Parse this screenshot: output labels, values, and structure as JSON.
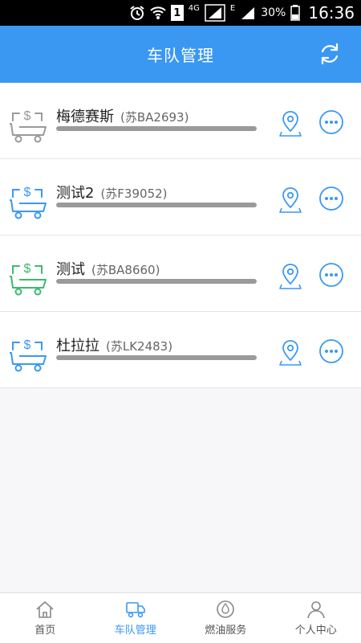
{
  "status_bar": {
    "time": "16:36",
    "battery": "30%",
    "network_4g": "4G",
    "network_e": "E",
    "sim": "1"
  },
  "header": {
    "title": "车队管理",
    "refresh_icon": "refresh-icon"
  },
  "colors": {
    "primary": "#3a98f3",
    "truck_gray": "#9a9a9a",
    "truck_blue": "#3a98f3",
    "truck_green": "#3cba6e"
  },
  "vehicles": [
    {
      "name": "梅德赛斯",
      "plate": "(苏BA2693)",
      "truck_color": "#9a9a9a"
    },
    {
      "name": "测试2",
      "plate": "(苏F39052)",
      "truck_color": "#3a98f3"
    },
    {
      "name": "测试",
      "plate": "(苏BA8660)",
      "truck_color": "#3cba6e"
    },
    {
      "name": "杜拉拉",
      "plate": "(苏LK2483)",
      "truck_color": "#3a98f3"
    }
  ],
  "tabs": [
    {
      "label": "首页",
      "icon": "home-icon",
      "active": false
    },
    {
      "label": "车队管理",
      "icon": "truck-icon",
      "active": true
    },
    {
      "label": "燃油服务",
      "icon": "fuel-drop-icon",
      "active": false
    },
    {
      "label": "个人中心",
      "icon": "person-icon",
      "active": false
    }
  ]
}
